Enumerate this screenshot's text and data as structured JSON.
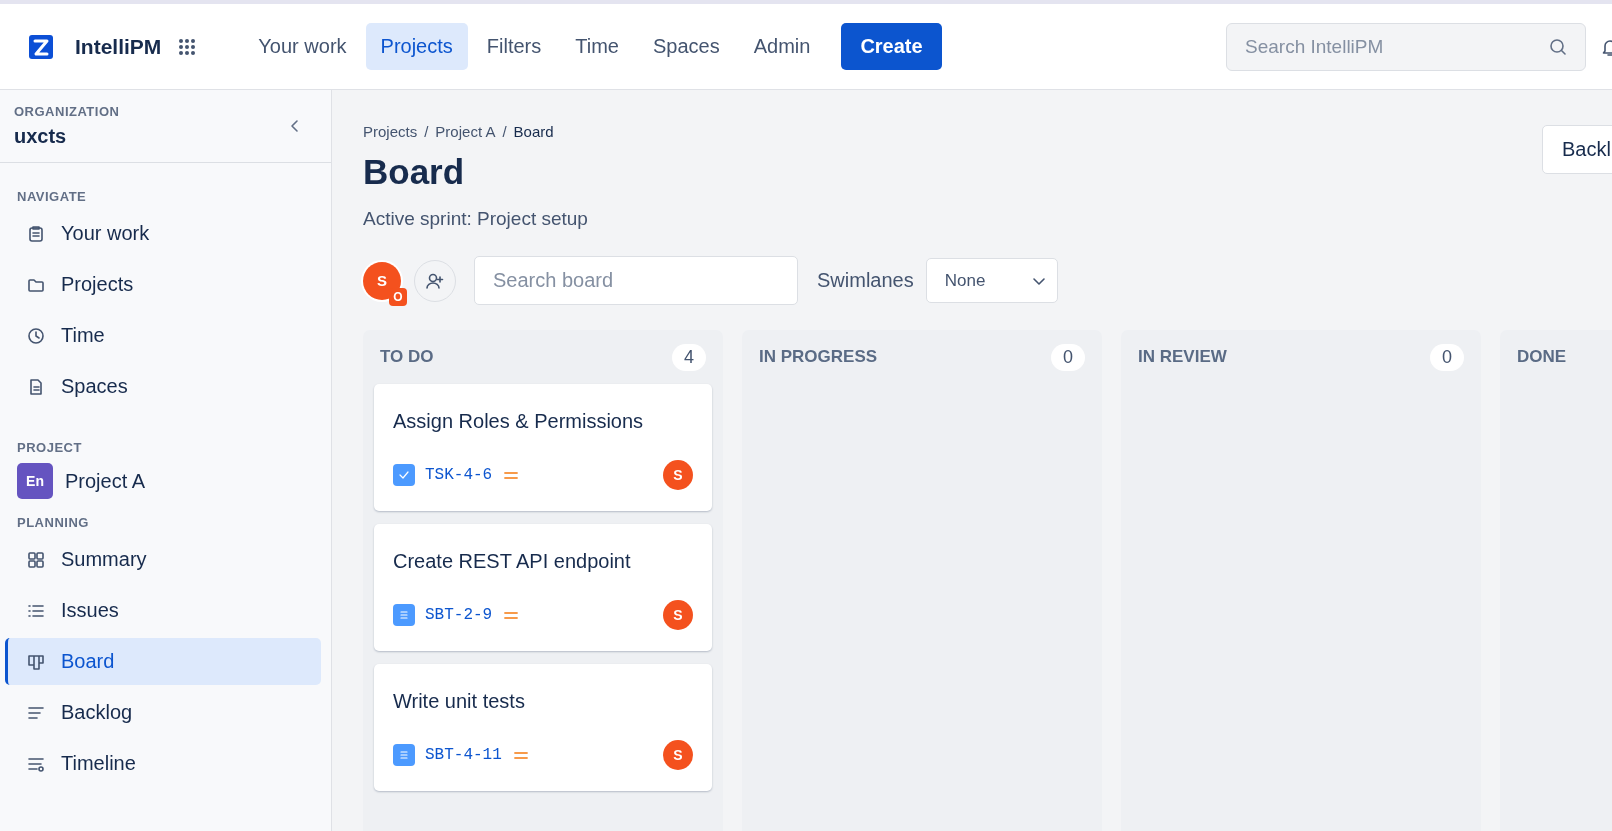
{
  "header": {
    "app_name": "IntelliPM",
    "nav": [
      {
        "label": "Your work",
        "selected": false
      },
      {
        "label": "Projects",
        "selected": true
      },
      {
        "label": "Filters",
        "selected": false
      },
      {
        "label": "Time",
        "selected": false
      },
      {
        "label": "Spaces",
        "selected": false
      },
      {
        "label": "Admin",
        "selected": false
      }
    ],
    "create_label": "Create",
    "search": {
      "placeholder": "Search IntelliPM"
    }
  },
  "sidebar": {
    "org_label": "ORGANIZATION",
    "org_name": "uxcts",
    "sections": [
      {
        "title": "NAVIGATE",
        "items": [
          {
            "label": "Your work",
            "selected": false
          },
          {
            "label": "Projects",
            "selected": false
          },
          {
            "label": "Time",
            "selected": false
          },
          {
            "label": "Spaces",
            "selected": false
          }
        ]
      },
      {
        "title": "PROJECT",
        "project": {
          "initials": "En",
          "name": "Project A"
        }
      },
      {
        "title": "PLANNING",
        "items": [
          {
            "label": "Summary",
            "selected": false
          },
          {
            "label": "Issues",
            "selected": false
          },
          {
            "label": "Board",
            "selected": true
          },
          {
            "label": "Backlog",
            "selected": false
          },
          {
            "label": "Timeline",
            "selected": false
          }
        ]
      }
    ]
  },
  "main": {
    "breadcrumb": [
      {
        "label": "Projects",
        "separator": "/"
      },
      {
        "label": "Project A",
        "separator": "/"
      },
      {
        "label": "Board"
      }
    ],
    "title": "Board",
    "subtitle": "Active sprint: Project setup",
    "top_button": "Backl",
    "toolbar": {
      "avatar": "S",
      "avatar_badge": "O",
      "search": {
        "placeholder": "Search board"
      },
      "swimlanes_label": "Swimlanes",
      "swimlanes_value": "None"
    },
    "columns": [
      {
        "title": "TO DO",
        "count": "4",
        "cards": [
          {
            "title": "Assign Roles & Permissions",
            "key": "TSK-4-6",
            "kind": "task",
            "assignee": "S"
          },
          {
            "title": "Create REST API endpoint",
            "key": "SBT-2-9",
            "kind": "subtask",
            "assignee": "S"
          },
          {
            "title": "Write unit tests",
            "key": "SBT-4-11",
            "kind": "subtask",
            "assignee": "S"
          }
        ]
      },
      {
        "title": "IN PROGRESS",
        "count": "0"
      },
      {
        "title": "IN REVIEW",
        "count": "0"
      },
      {
        "title": "DONE"
      }
    ]
  }
}
